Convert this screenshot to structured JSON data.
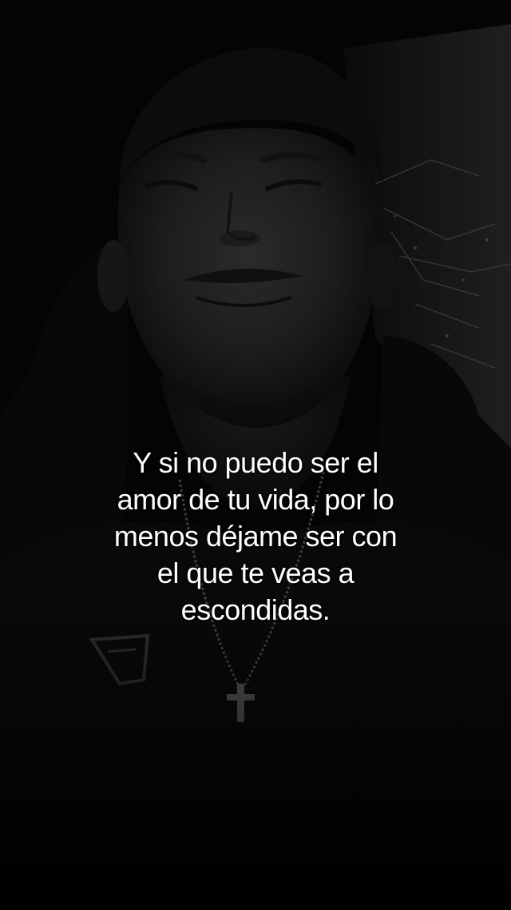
{
  "caption": {
    "lines": [
      "Y si no puedo ser el",
      "amor de tu vida, por lo",
      "menos déjame ser con",
      "el que te veas a",
      "escondidas."
    ]
  },
  "colors": {
    "background": "#050505",
    "caption_text": "#ffffff"
  }
}
